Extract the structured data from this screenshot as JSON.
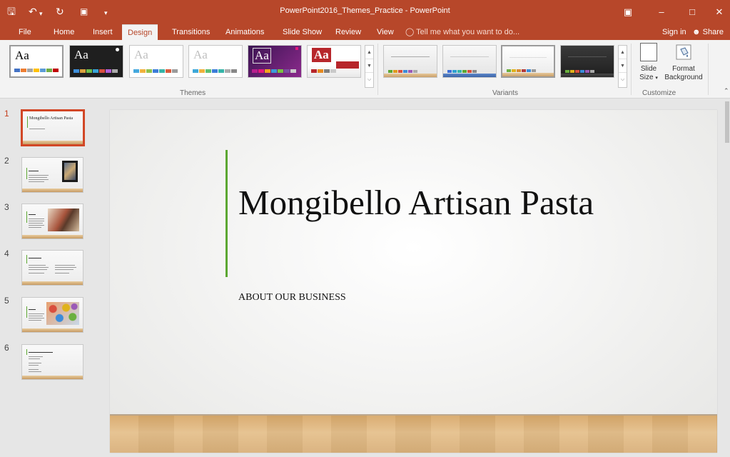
{
  "titlebar": {
    "title": "PowerPoint2016_Themes_Practice - PowerPoint",
    "save_icon": "save-icon",
    "undo_icon": "undo-icon",
    "redo_icon": "redo-icon",
    "present_icon": "present-from-beginning-icon",
    "customize_icon": "customize-qat-icon"
  },
  "tabs": [
    {
      "label": "File"
    },
    {
      "label": "Home"
    },
    {
      "label": "Insert"
    },
    {
      "label": "Design"
    },
    {
      "label": "Transitions"
    },
    {
      "label": "Animations"
    },
    {
      "label": "Slide Show"
    },
    {
      "label": "Review"
    },
    {
      "label": "View"
    }
  ],
  "tellme": "Tell me what you want to do...",
  "account": {
    "signin": "Sign in",
    "share": "Share"
  },
  "ribbon": {
    "themes_label": "Themes",
    "variants_label": "Variants",
    "customize_label": "Customize",
    "slide_size_line1": "Slide",
    "slide_size_line2": "Size",
    "format_bg_line1": "Format",
    "format_bg_line2": "Background",
    "themes": [
      {
        "aa": "Aa",
        "bg": "#ffffff",
        "fg": "#000000"
      },
      {
        "aa": "Aa",
        "bg": "#1f1f1f",
        "fg": "#ffffff"
      },
      {
        "aa": "Aa",
        "bg": "#ffffff",
        "fg": "#c0c0c0"
      },
      {
        "aa": "Aa",
        "bg": "#ffffff",
        "fg": "#c0c0c0"
      },
      {
        "aa": "Aa",
        "bg": "#5a1f73",
        "fg": "#ffffff"
      },
      {
        "aa": "Aa",
        "bg": "#ffffff",
        "fg": "#b7262b"
      }
    ]
  },
  "slides": [
    {
      "number": "1",
      "title": "Mongibello Artisan Pasta"
    },
    {
      "number": "2"
    },
    {
      "number": "3"
    },
    {
      "number": "4"
    },
    {
      "number": "5"
    },
    {
      "number": "6"
    }
  ],
  "current_slide": {
    "title": "Mongibello Artisan Pasta",
    "subtitle": "ABOUT OUR BUSINESS"
  },
  "colors": {
    "accent": "#b7472a",
    "title_green_line": "#5ca732"
  }
}
